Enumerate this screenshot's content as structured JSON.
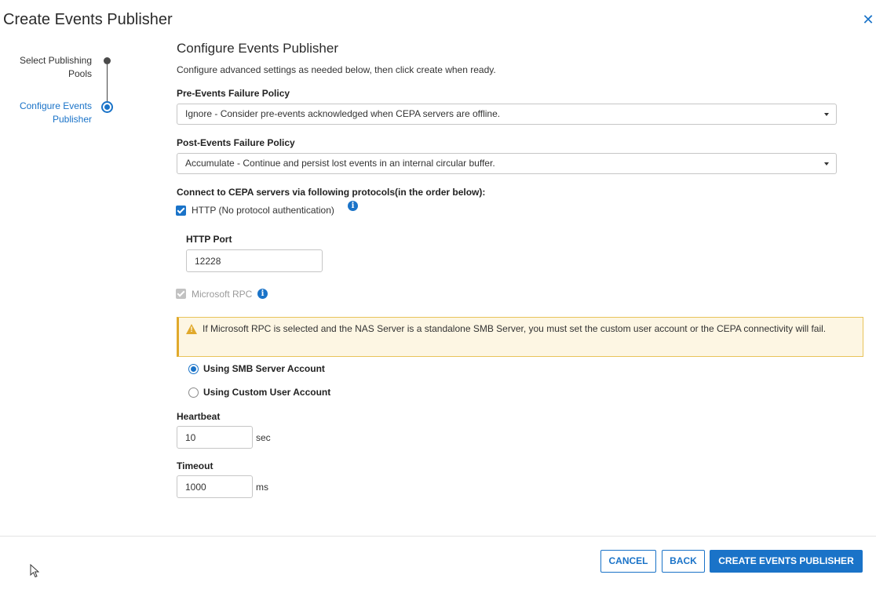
{
  "dialog": {
    "title": "Create Events Publisher",
    "close_icon": "close-icon",
    "close_glyph": "✕"
  },
  "stepper": {
    "steps": [
      {
        "label": "Select Publishing Pools",
        "state": "complete"
      },
      {
        "label": "Configure Events Publisher",
        "state": "current"
      }
    ]
  },
  "section": {
    "title": "Configure Events Publisher",
    "subtitle": "Configure advanced settings as needed below, then click create when ready."
  },
  "pre_events": {
    "label": "Pre-Events Failure Policy",
    "value": "Ignore - Consider pre-events acknowledged when CEPA servers are offline."
  },
  "post_events": {
    "label": "Post-Events Failure Policy",
    "value": "Accumulate - Continue and persist lost events in an internal circular buffer."
  },
  "protocols": {
    "label": "Connect to CEPA servers via following protocols(in the order below):",
    "http": {
      "label": "HTTP (No protocol authentication)",
      "checked": true
    },
    "http_port": {
      "label": "HTTP Port",
      "value": "12228"
    },
    "rpc": {
      "label": "Microsoft RPC",
      "checked": true,
      "disabled": true
    }
  },
  "warning": {
    "text": "If Microsoft RPC is selected and the NAS Server is a standalone SMB Server, you must set the custom user account or the CEPA connectivity will fail."
  },
  "account": {
    "options": [
      {
        "label": "Using SMB Server Account",
        "selected": true
      },
      {
        "label": "Using Custom User Account",
        "selected": false
      }
    ]
  },
  "heartbeat": {
    "label": "Heartbeat",
    "value": "10",
    "unit": "sec"
  },
  "timeout": {
    "label": "Timeout",
    "value": "1000",
    "unit": "ms"
  },
  "footer": {
    "cancel": "CANCEL",
    "back": "BACK",
    "create": "CREATE EVENTS PUBLISHER"
  },
  "colors": {
    "accent": "#1a73c8",
    "warning_border": "#e1a92b",
    "warning_bg": "#fdf6e3"
  }
}
